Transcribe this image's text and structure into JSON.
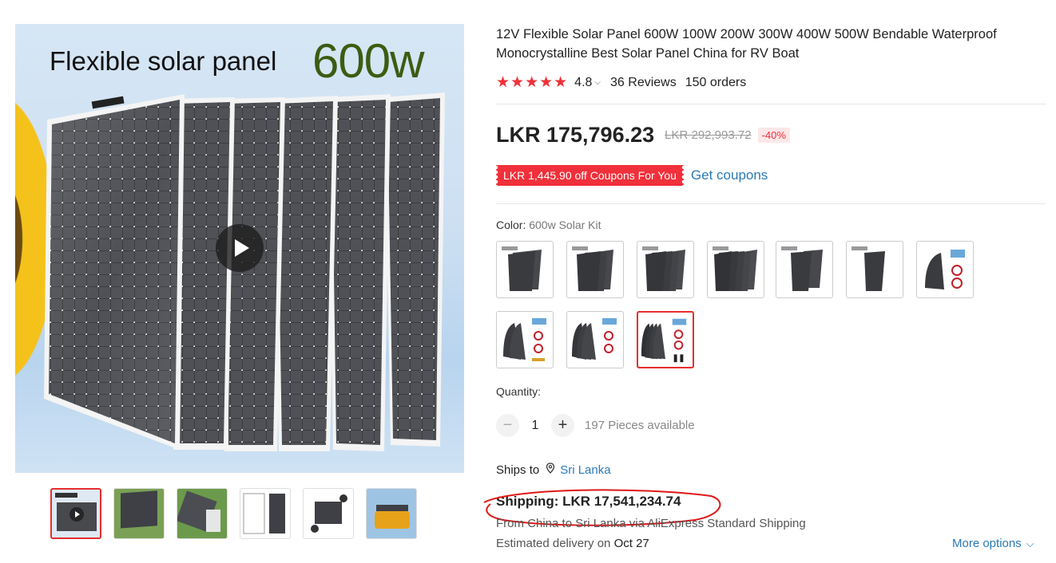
{
  "main_image": {
    "title_text": "Flexible solar panel",
    "watt_text": "600w"
  },
  "thumbnails": [
    {
      "name": "thumb-1",
      "active": true,
      "video": true
    },
    {
      "name": "thumb-2"
    },
    {
      "name": "thumb-3"
    },
    {
      "name": "thumb-4"
    },
    {
      "name": "thumb-5"
    },
    {
      "name": "thumb-6"
    }
  ],
  "product": {
    "title": "12V Flexible Solar Panel 600W 100W 200W 300W 400W 500W Bendable Waterproof Monocrystalline Best Solar Panel China for RV Boat",
    "stars": "★★★★★",
    "rating": "4.8",
    "rating_caret": "⌵",
    "reviews": "36 Reviews",
    "orders": "150 orders"
  },
  "price": {
    "current": "LKR 175,796.23",
    "original": "LKR 292,993.72",
    "discount": "-40%"
  },
  "coupon": {
    "label": "LKR 1,445.90 off Coupons For You",
    "action": "Get coupons"
  },
  "color": {
    "label": "Color: ",
    "selected": "600w Solar Kit",
    "selected_index": 9
  },
  "quantity": {
    "label": "Quantity:",
    "minus": "−",
    "value": "1",
    "plus": "+",
    "available": "197 Pieces available"
  },
  "shipping": {
    "ships_to_label": "Ships to",
    "country": "Sri Lanka",
    "cost": "Shipping: LKR 17,541,234.74",
    "detail": "From China to Sri Lanka via AliExpress Standard Shipping",
    "delivery_label": "Estimated delivery on ",
    "delivery_date": "Oct 27",
    "more_options": "More options",
    "more_chevron": "⌵"
  },
  "colors": {
    "accent": "#f0303a",
    "link": "#2a7ab6",
    "selected_border": "#e62e2e"
  }
}
